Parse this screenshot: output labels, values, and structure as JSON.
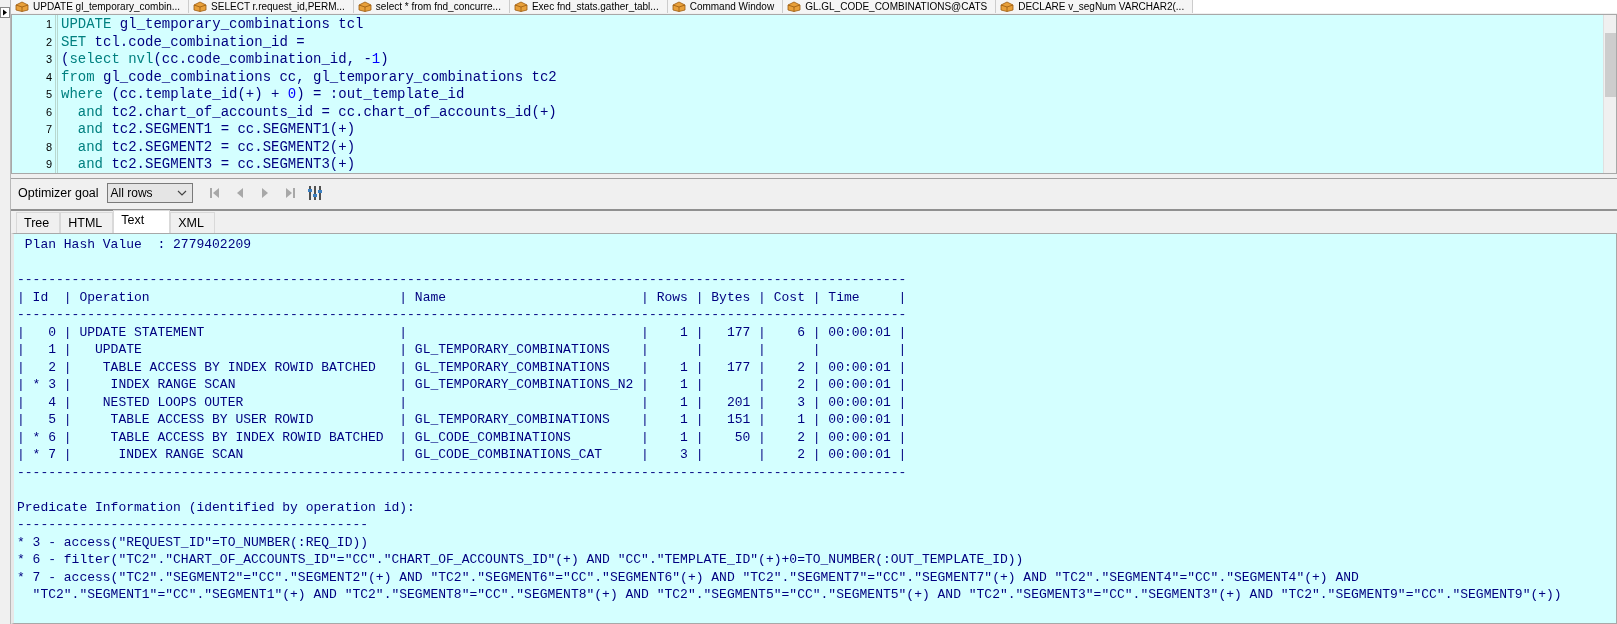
{
  "document_tabs": [
    {
      "label": "UPDATE gl_temporary_combin..."
    },
    {
      "label": "SELECT r.request_id,PERM..."
    },
    {
      "label": "select * from fnd_concurre..."
    },
    {
      "label": "Exec fnd_stats.gather_tabl..."
    },
    {
      "label": "Command Window"
    },
    {
      "label": "GL.GL_CODE_COMBINATIONS@CATS"
    },
    {
      "label": "DECLARE v_segNum VARCHAR2(..."
    }
  ],
  "editor": {
    "lines": [
      {
        "number": "1",
        "tokens": [
          {
            "kind": "keyword",
            "text": "UPDATE"
          },
          {
            "kind": "plain",
            "text": " gl_temporary_combinations tcl"
          }
        ]
      },
      {
        "number": "2",
        "tokens": [
          {
            "kind": "keyword",
            "text": "SET"
          },
          {
            "kind": "plain",
            "text": " tcl.code_combination_id ="
          }
        ]
      },
      {
        "number": "3",
        "tokens": [
          {
            "kind": "plain",
            "text": "("
          },
          {
            "kind": "keyword",
            "text": "select nvl"
          },
          {
            "kind": "plain",
            "text": "(cc.code_combination_id, -"
          },
          {
            "kind": "number",
            "text": "1"
          },
          {
            "kind": "plain",
            "text": ")"
          }
        ]
      },
      {
        "number": "4",
        "tokens": [
          {
            "kind": "keyword",
            "text": "from"
          },
          {
            "kind": "plain",
            "text": " gl_code_combinations cc, gl_temporary_combinations tc2"
          }
        ]
      },
      {
        "number": "5",
        "tokens": [
          {
            "kind": "keyword",
            "text": "where"
          },
          {
            "kind": "plain",
            "text": " (cc.template_id(+) + "
          },
          {
            "kind": "number",
            "text": "0"
          },
          {
            "kind": "plain",
            "text": ") = :out_template_id"
          }
        ]
      },
      {
        "number": "6",
        "tokens": [
          {
            "kind": "keyword",
            "text": "  and"
          },
          {
            "kind": "plain",
            "text": " tc2.chart_of_accounts_id = cc.chart_of_accounts_id(+)"
          }
        ]
      },
      {
        "number": "7",
        "tokens": [
          {
            "kind": "keyword",
            "text": "  and"
          },
          {
            "kind": "plain",
            "text": " tc2.SEGMENT1 = cc.SEGMENT1(+)"
          }
        ]
      },
      {
        "number": "8",
        "tokens": [
          {
            "kind": "keyword",
            "text": "  and"
          },
          {
            "kind": "plain",
            "text": " tc2.SEGMENT2 = cc.SEGMENT2(+)"
          }
        ]
      },
      {
        "number": "9",
        "tokens": [
          {
            "kind": "keyword",
            "text": "  and"
          },
          {
            "kind": "plain",
            "text": " tc2.SEGMENT3 = cc.SEGMENT3(+)"
          }
        ]
      }
    ]
  },
  "toolbar": {
    "label": "Optimizer goal",
    "goal": "All rows",
    "buttons": [
      {
        "kind": "first",
        "disabled": true
      },
      {
        "kind": "prev",
        "disabled": true
      },
      {
        "kind": "next",
        "disabled": true
      },
      {
        "kind": "last",
        "disabled": true
      },
      {
        "kind": "columns",
        "disabled": false
      }
    ]
  },
  "result_tabs": [
    {
      "label": "Tree",
      "selected": false
    },
    {
      "label": "HTML",
      "selected": false
    },
    {
      "label": "Text",
      "selected": true
    },
    {
      "label": "XML",
      "selected": false
    }
  ],
  "plan": {
    "lines": [
      {
        "kind": "hash",
        "text": " Plan Hash Value  : 2779402209"
      },
      {
        "kind": "gap"
      },
      {
        "kind": "rule",
        "text": "------------------------------------------------------------------------------------------------------------------"
      },
      {
        "kind": "header",
        "text": "| Id  | Operation                                | Name                         | Rows | Bytes | Cost | Time     |"
      },
      {
        "kind": "rule",
        "text": "------------------------------------------------------------------------------------------------------------------"
      },
      {
        "kind": "row",
        "text": "|   0 | UPDATE STATEMENT                         |                              |    1 |   177 |    6 | 00:00:01 |"
      },
      {
        "kind": "row",
        "text": "|   1 |   UPDATE                                 | GL_TEMPORARY_COMBINATIONS    |      |       |      |          |"
      },
      {
        "kind": "row",
        "text": "|   2 |    TABLE ACCESS BY INDEX ROWID BATCHED   | GL_TEMPORARY_COMBINATIONS    |    1 |   177 |    2 | 00:00:01 |"
      },
      {
        "kind": "row",
        "text": "| * 3 |     INDEX RANGE SCAN                     | GL_TEMPORARY_COMBINATIONS_N2 |    1 |       |    2 | 00:00:01 |"
      },
      {
        "kind": "row",
        "text": "|   4 |    NESTED LOOPS OUTER                    |                              |    1 |   201 |    3 | 00:00:01 |"
      },
      {
        "kind": "row",
        "text": "|   5 |     TABLE ACCESS BY USER ROWID           | GL_TEMPORARY_COMBINATIONS    |    1 |   151 |    1 | 00:00:01 |"
      },
      {
        "kind": "row",
        "text": "| * 6 |     TABLE ACCESS BY INDEX ROWID BATCHED  | GL_CODE_COMBINATIONS         |    1 |    50 |    2 | 00:00:01 |"
      },
      {
        "kind": "row",
        "text": "| * 7 |      INDEX RANGE SCAN                    | GL_CODE_COMBINATIONS_CAT     |    3 |       |    2 | 00:00:01 |"
      },
      {
        "kind": "rule",
        "text": "------------------------------------------------------------------------------------------------------------------"
      },
      {
        "kind": "gap"
      },
      {
        "kind": "title",
        "text": "Predicate Information (identified by operation id):"
      },
      {
        "kind": "rule",
        "text": "---------------------------------------------"
      },
      {
        "kind": "predicate",
        "text": "* 3 - access(\"REQUEST_ID\"=TO_NUMBER(:REQ_ID))"
      },
      {
        "kind": "predicate",
        "text": "* 6 - filter(\"TC2\".\"CHART_OF_ACCOUNTS_ID\"=\"CC\".\"CHART_OF_ACCOUNTS_ID\"(+) AND \"CC\".\"TEMPLATE_ID\"(+)+0=TO_NUMBER(:OUT_TEMPLATE_ID))"
      },
      {
        "kind": "predicate",
        "text": "* 7 - access(\"TC2\".\"SEGMENT2\"=\"CC\".\"SEGMENT2\"(+) AND \"TC2\".\"SEGMENT6\"=\"CC\".\"SEGMENT6\"(+) AND \"TC2\".\"SEGMENT7\"=\"CC\".\"SEGMENT7\"(+) AND \"TC2\".\"SEGMENT4\"=\"CC\".\"SEGMENT4\"(+) AND"
      },
      {
        "kind": "predicate",
        "text": "  \"TC2\".\"SEGMENT1\"=\"CC\".\"SEGMENT1\"(+) AND \"TC2\".\"SEGMENT8\"=\"CC\".\"SEGMENT8\"(+) AND \"TC2\".\"SEGMENT5\"=\"CC\".\"SEGMENT5\"(+) AND \"TC2\".\"SEGMENT3\"=\"CC\".\"SEGMENT3\"(+) AND \"TC2\".\"SEGMENT9\"=\"CC\".\"SEGMENT9\"(+))"
      }
    ]
  }
}
